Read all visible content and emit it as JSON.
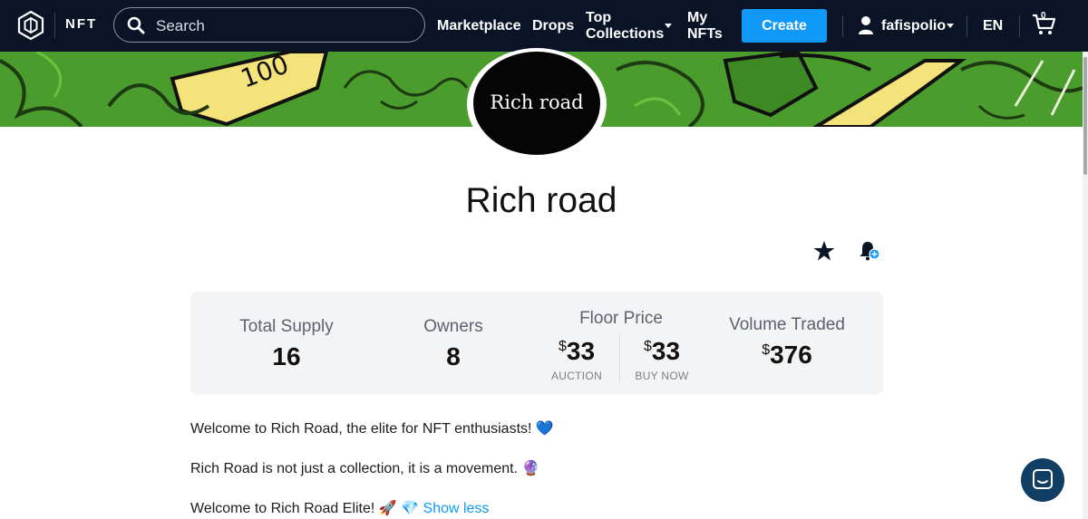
{
  "nav": {
    "brand": "NFT",
    "search_placeholder": "Search",
    "links": {
      "marketplace": "Marketplace",
      "drops": "Drops",
      "top_collections_line1": "Top",
      "top_collections_line2": "Collections",
      "my_nfts_line1": "My",
      "my_nfts_line2": "NFTs"
    },
    "create_label": "Create",
    "username": "fafispolio",
    "language": "EN",
    "cart_count": "0"
  },
  "collection": {
    "avatar_text": "Rich road",
    "title": "Rich road"
  },
  "stats": {
    "total_supply_label": "Total Supply",
    "total_supply_value": "16",
    "owners_label": "Owners",
    "owners_value": "8",
    "floor_price_label": "Floor Price",
    "currency_symbol": "$",
    "auction_value": "33",
    "auction_label": "AUCTION",
    "buy_now_value": "33",
    "buy_now_label": "BUY NOW",
    "volume_label": "Volume Traded",
    "volume_value": "376"
  },
  "description": {
    "line1": "Welcome to Rich Road, the elite for NFT enthusiasts! 💙",
    "line2": "Rich Road is not just a collection, it is a movement. 🔮",
    "line3": "Welcome to Rich Road Elite! 🚀 💎",
    "show_less": "Show less"
  },
  "colors": {
    "nav_bg": "#0b1426",
    "accent": "#1199fa",
    "banner_green": "#4a9d2c",
    "banner_yellow": "#f4e27a"
  },
  "icons": [
    "logo-icon",
    "search-icon",
    "user-icon",
    "cart-icon",
    "star-icon",
    "bell-plus-icon",
    "chat-icon"
  ]
}
